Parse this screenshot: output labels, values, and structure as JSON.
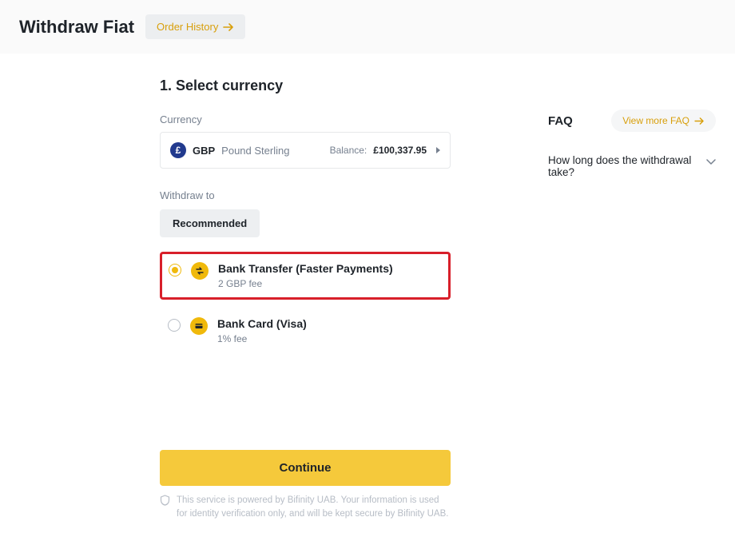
{
  "header": {
    "title": "Withdraw Fiat",
    "order_history": "Order History"
  },
  "step": {
    "title": "1. Select currency",
    "currency_label": "Currency",
    "currency_code": "GBP",
    "currency_name": "Pound Sterling",
    "balance_label": "Balance:",
    "balance_value": "£100,337.95",
    "withdraw_to_label": "Withdraw to",
    "recommended_tab": "Recommended",
    "options": [
      {
        "name": "Bank Transfer (Faster Payments)",
        "fee": "2 GBP fee",
        "selected": true
      },
      {
        "name": "Bank Card (Visa)",
        "fee": "1% fee",
        "selected": false
      }
    ],
    "continue": "Continue",
    "disclaimer": "This service is powered by Bifinity UAB. Your information is used for identity verification only, and will be kept secure by Bifinity UAB."
  },
  "faq": {
    "title": "FAQ",
    "view_more": "View more FAQ",
    "items": [
      "How long does the withdrawal take?"
    ]
  }
}
